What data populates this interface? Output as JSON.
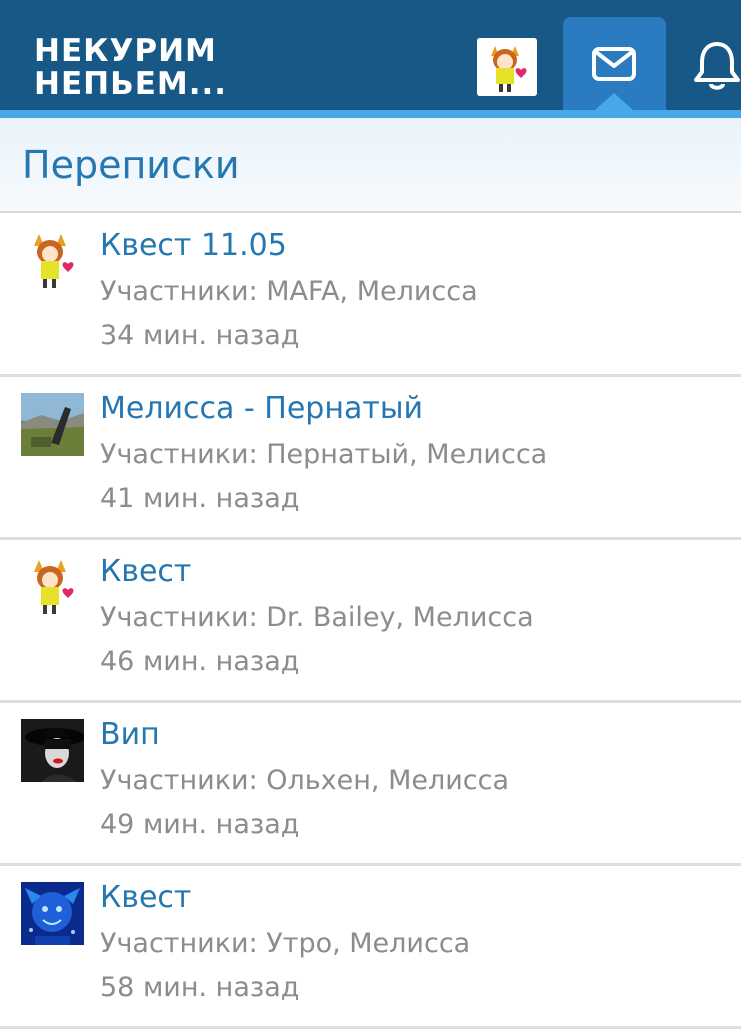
{
  "header": {
    "logo_line1": "НЕКУРИМ",
    "logo_line2": "НЕПЬЕМ...",
    "inbox_icon": "envelope-icon",
    "alerts_icon": "bell-icon",
    "colors": {
      "header_bg": "#185886",
      "active_tab": "#2a7bc0",
      "stripe": "#47a7eb"
    }
  },
  "page": {
    "title": "Переписки"
  },
  "conversations": [
    {
      "title": "Квест 11.05",
      "participants": "Участники: MAFA, Мелисса",
      "time": "34 мин. назад",
      "avatar": "anime-fox-girl"
    },
    {
      "title": "Мелисса - Пернатый",
      "participants": "Участники: Пернатый, Мелисса",
      "time": "41 мин. назад",
      "avatar": "landscape-photo"
    },
    {
      "title": "Квест",
      "participants": "Участники: Dr. Bailey, Мелисса",
      "time": "46 мин. назад",
      "avatar": "anime-fox-girl"
    },
    {
      "title": "Вип",
      "participants": "Участники: Ольхен, Мелисса",
      "time": "49 мин. назад",
      "avatar": "woman-in-hat-photo"
    },
    {
      "title": "Квест",
      "participants": "Участники: Утро, Мелисса",
      "time": "58 мин. назад",
      "avatar": "blue-jester-image"
    }
  ],
  "colors": {
    "link": "#2577b1",
    "muted_text": "#8c8c8c",
    "divider": "#dedede"
  }
}
